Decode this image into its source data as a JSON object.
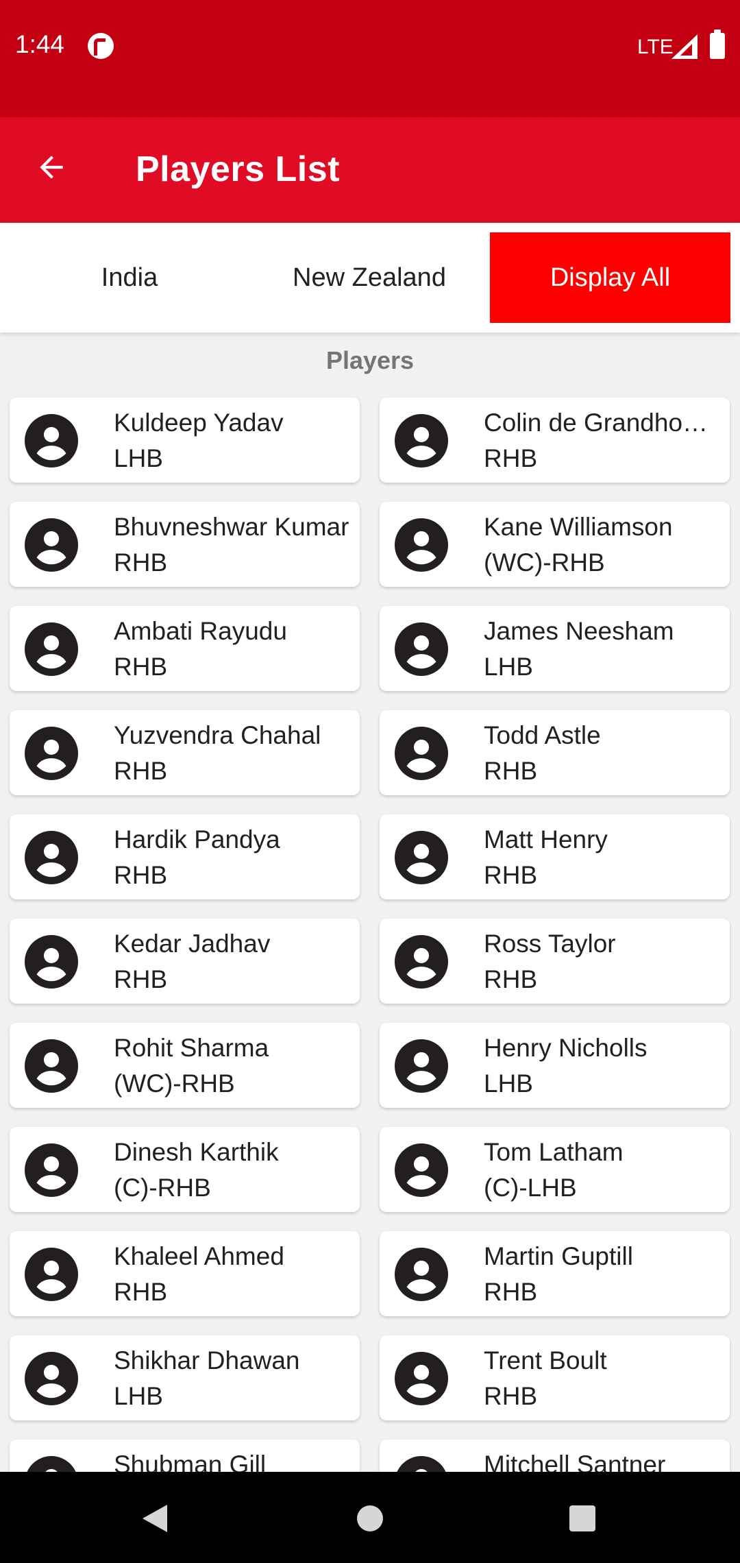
{
  "status_bar": {
    "time": "1:44",
    "network": "LTE"
  },
  "app_bar": {
    "title": "Players List"
  },
  "tabs": [
    {
      "label": "India",
      "active": false
    },
    {
      "label": "New Zealand",
      "active": false
    },
    {
      "label": "Display All",
      "active": true
    }
  ],
  "section_title": "Players",
  "players": [
    {
      "left": {
        "name": "Kuldeep Yadav",
        "role": "LHB"
      },
      "right": {
        "name": "Colin de Grandhomme",
        "role": "RHB"
      }
    },
    {
      "left": {
        "name": "Bhuvneshwar Kumar",
        "role": "RHB"
      },
      "right": {
        "name": "Kane Williamson",
        "role": "(WC)-RHB"
      }
    },
    {
      "left": {
        "name": "Ambati Rayudu",
        "role": "RHB"
      },
      "right": {
        "name": "James Neesham",
        "role": "LHB"
      }
    },
    {
      "left": {
        "name": "Yuzvendra Chahal",
        "role": "RHB"
      },
      "right": {
        "name": "Todd Astle",
        "role": "RHB"
      }
    },
    {
      "left": {
        "name": "Hardik Pandya",
        "role": "RHB"
      },
      "right": {
        "name": "Matt Henry",
        "role": "RHB"
      }
    },
    {
      "left": {
        "name": "Kedar Jadhav",
        "role": "RHB"
      },
      "right": {
        "name": "Ross Taylor",
        "role": "RHB"
      }
    },
    {
      "left": {
        "name": "Rohit Sharma",
        "role": "(WC)-RHB"
      },
      "right": {
        "name": "Henry Nicholls",
        "role": "LHB"
      }
    },
    {
      "left": {
        "name": "Dinesh Karthik",
        "role": "(C)-RHB"
      },
      "right": {
        "name": "Tom Latham",
        "role": "(C)-LHB"
      }
    },
    {
      "left": {
        "name": "Khaleel Ahmed",
        "role": "RHB"
      },
      "right": {
        "name": "Martin Guptill",
        "role": "RHB"
      }
    },
    {
      "left": {
        "name": "Shikhar Dhawan",
        "role": "LHB"
      },
      "right": {
        "name": "Trent Boult",
        "role": "RHB"
      }
    },
    {
      "left": {
        "name": "Shubman Gill",
        "role": ""
      },
      "right": {
        "name": "Mitchell Santner",
        "role": ""
      }
    }
  ],
  "icons": {
    "back": "arrow-back-icon",
    "avatar": "account-circle-icon",
    "nav_back": "triangle-back-icon",
    "nav_home": "circle-home-icon",
    "nav_recents": "square-recents-icon"
  },
  "colors": {
    "status_bar": "#c20012",
    "app_bar": "#e00c26",
    "active_tab": "#ff0000",
    "avatar": "#231f20"
  }
}
